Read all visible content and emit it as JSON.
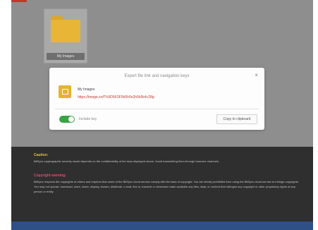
{
  "colors": {
    "accent_red": "#c0392b",
    "folder_yellow": "#e9b536",
    "toggle_green": "#3aa346",
    "caution_yellow": "#e6c02e",
    "copyright_pink": "#e14b6a",
    "notice_bg": "#2f2f2f",
    "bottom_blue": "#2f4f87"
  },
  "desktop": {
    "folder_tile": {
      "icon": "folder-icon",
      "label": "My Images"
    }
  },
  "dialog": {
    "title": "Export file link and navigation keys",
    "close_icon": "close-icon",
    "file": {
      "icon": "shared-file-icon",
      "name": "My Images",
      "link": "https://image.cn/f?c5D5K3F5h5h5n2h5h5k4rJ3fg"
    },
    "toggle": {
      "label": "Include key",
      "state": "on"
    },
    "copy_button_label": "Copy to clipboard"
  },
  "notice": {
    "caution_heading": "Caution:",
    "caution_text": "BitSync cryptographic security model depends on the confidentiality of the keys displayed above. Avoid transmitting them through insecure channels.",
    "copyright_heading": "Copyright warning:",
    "copyright_text": "BitSync respects the copyrights of others and requires that users of the BitSync cloud service comply with the laws of copyright. You are strictly prohibited from using the BitSync cloud service to infringe copyrights. You may not upload, download, store, share, display, stream, distribute, e-mail, link to, transmit or otherwise make available any files, data, or content that infringes any copyright or other proprietary rights of any person or entity."
  }
}
